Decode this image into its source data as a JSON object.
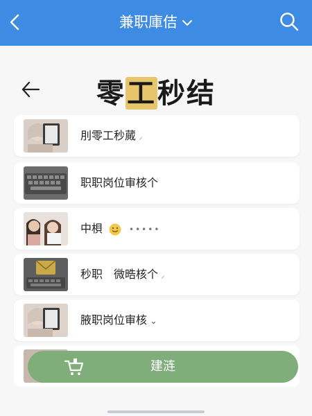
{
  "topbar": {
    "title": "兼职庫佶",
    "back_icon": "chevron-left-icon",
    "search_icon": "search-icon",
    "color": "#3d8be3"
  },
  "header": {
    "title_left": "零",
    "title_highlight": "工",
    "title_right": "秒结"
  },
  "items": [
    {
      "label": "刖零工秒蕆",
      "suffix": "⸝"
    },
    {
      "label": "职职岗位审核个",
      "suffix": ""
    },
    {
      "label": "中梖",
      "suffix": "•••••"
    },
    {
      "label": "秒职　微晧核个",
      "suffix": "⸝"
    },
    {
      "label": "腋职岗位审核",
      "suffix": "⌄"
    }
  ],
  "cta": {
    "label": "建涟",
    "color": "#7fae7a"
  }
}
